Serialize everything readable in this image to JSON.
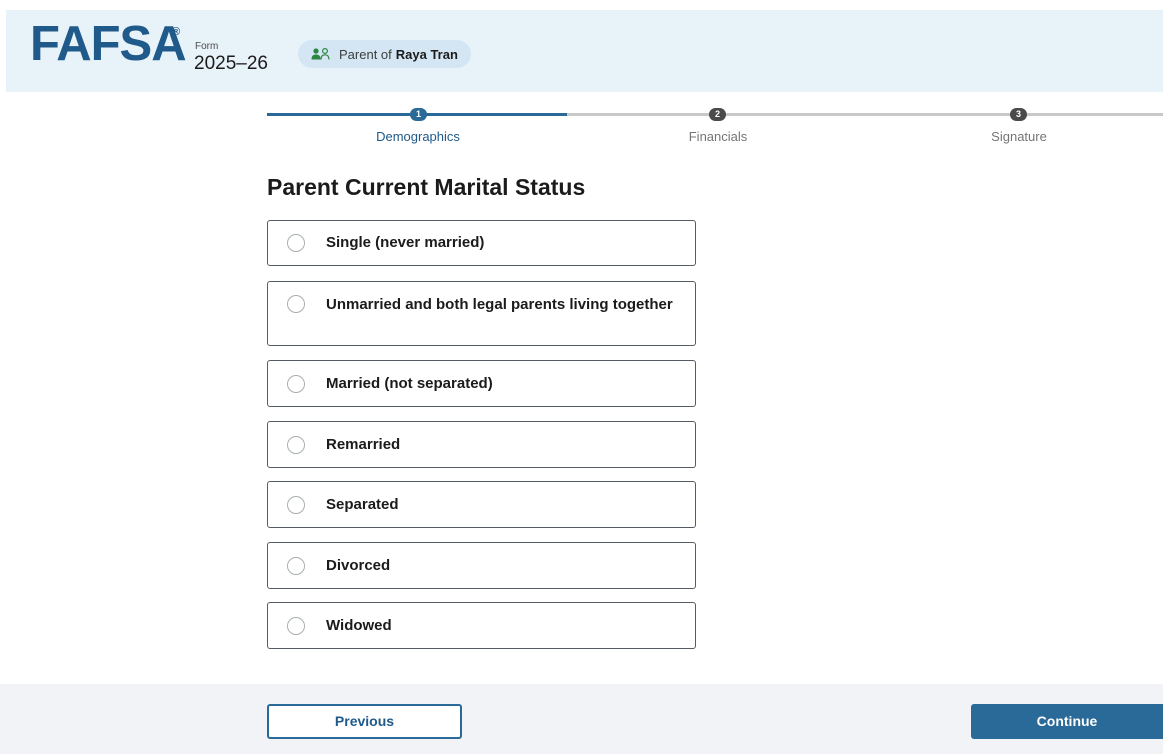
{
  "header": {
    "logo_text": "FAFSA",
    "logo_mark": "®",
    "form_label": "Form",
    "form_year": "2025–26",
    "badge": {
      "icon": "people-icon",
      "prefix": "Parent of",
      "name": "Raya Tran"
    }
  },
  "stepper": {
    "steps": [
      {
        "number": "1",
        "label": "Demographics",
        "state": "current"
      },
      {
        "number": "2",
        "label": "Financials",
        "state": "upcoming"
      },
      {
        "number": "3",
        "label": "Signature",
        "state": "upcoming"
      }
    ],
    "colors": {
      "active": "#2a6a98",
      "inactive": "#4a4a4a",
      "inactive_line": "#c8c8c8",
      "inactive_label": "#757575"
    }
  },
  "question": {
    "title": "Parent Current Marital Status",
    "options": [
      {
        "label": "Single (never married)",
        "selected": false
      },
      {
        "label": "Unmarried and both legal parents living together",
        "selected": false
      },
      {
        "label": "Married (not separated)",
        "selected": false
      },
      {
        "label": "Remarried",
        "selected": false
      },
      {
        "label": "Separated",
        "selected": false
      },
      {
        "label": "Divorced",
        "selected": false
      },
      {
        "label": "Widowed",
        "selected": false
      }
    ]
  },
  "footer": {
    "previous_label": "Previous",
    "continue_label": "Continue"
  },
  "colors": {
    "brand": "#1f5a8a",
    "header_bg": "#e8f2f9",
    "badge_bg": "#d4e6f3",
    "primary_button": "#2a6a98",
    "footer_bg": "#f1f3f6"
  }
}
